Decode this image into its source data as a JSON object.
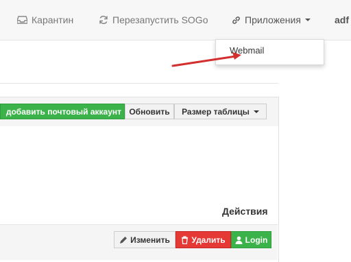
{
  "navbar": {
    "quarantine_label": "Карантин",
    "restart_label": "Перезапустить SOGo",
    "apps_label": "Приложения",
    "user_label": "adf"
  },
  "apps_dropdown": {
    "items": [
      {
        "label": "Webmail"
      }
    ]
  },
  "toolbar": {
    "add_mailbox_label": "добавить почтовый аккаунт",
    "refresh_label": "Обновить",
    "table_size_label": "Размер таблицы"
  },
  "table": {
    "actions_header": "Действия",
    "row_actions": {
      "edit_label": "Изменить",
      "delete_label": "Удалить",
      "login_label": "Login"
    }
  },
  "colors": {
    "success": "#3cb34a",
    "danger": "#e53935",
    "annotation_arrow": "#d32f2f"
  },
  "icons": {
    "quarantine": "inbox-icon",
    "restart": "refresh-icon",
    "apps": "link-icon",
    "edit": "pencil-icon",
    "delete": "trash-icon",
    "login": "user-icon"
  }
}
